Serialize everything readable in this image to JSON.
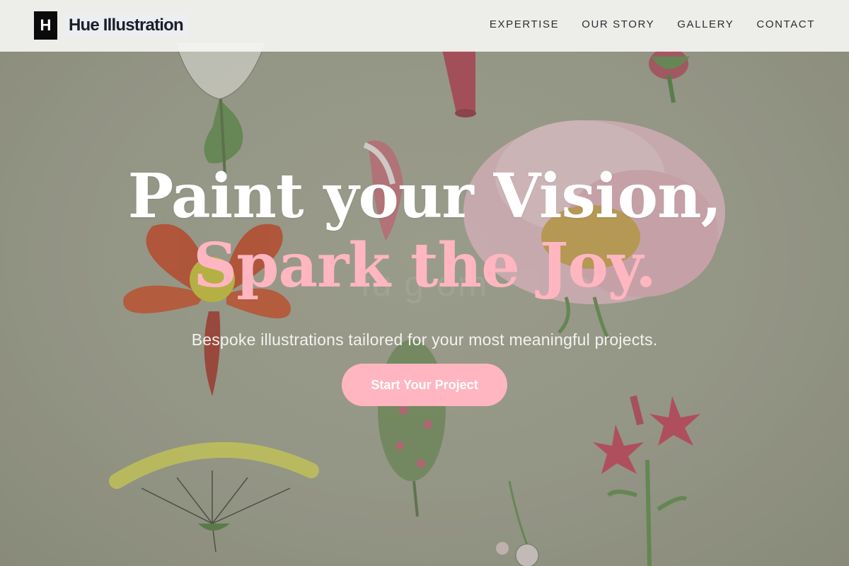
{
  "header": {
    "brand_mark": "H",
    "brand_name": "Hue Illustration",
    "nav": [
      {
        "label": "EXPERTISE"
      },
      {
        "label": "OUR STORY"
      },
      {
        "label": "GALLERY"
      },
      {
        "label": "CONTACT"
      }
    ]
  },
  "hero": {
    "title_line_1": "Paint your Vision,",
    "title_line_2": "Spark the Joy.",
    "watermark": "fu          g          om",
    "subtitle": "Bespoke illustrations tailored for your most meaningful projects.",
    "cta_label": "Start Your Project"
  },
  "colors": {
    "accent_pink": "#ffb6c1",
    "brand_black": "#0b0b0b",
    "header_bg": "#f4f4f1"
  }
}
